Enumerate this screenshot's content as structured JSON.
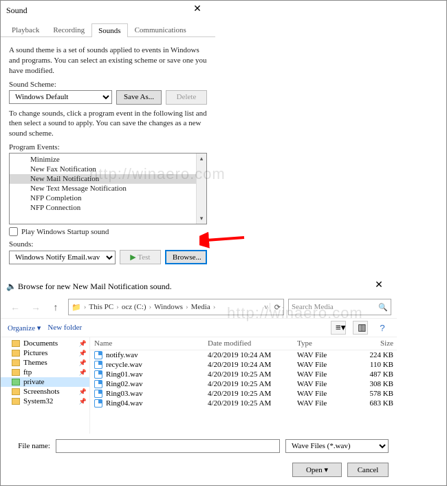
{
  "sound": {
    "title": "Sound",
    "tabs": [
      "Playback",
      "Recording",
      "Sounds",
      "Communications"
    ],
    "active_tab": 2,
    "intro": "A sound theme is a set of sounds applied to events in Windows and programs. You can select an existing scheme or save one you have modified.",
    "scheme_label": "Sound Scheme:",
    "scheme_value": "Windows Default",
    "save_as": "Save As...",
    "delete": "Delete",
    "change_hint": "To change sounds, click a program event in the following list and then select a sound to apply.  You can save the changes as a new sound scheme.",
    "events_label": "Program Events:",
    "events": [
      "Minimize",
      "New Fax Notification",
      "New Mail Notification",
      "New Text Message Notification",
      "NFP Completion",
      "NFP Connection"
    ],
    "selected_event": 2,
    "startup_label": "Play Windows Startup sound",
    "sounds_label": "Sounds:",
    "sound_value": "Windows Notify Email.wav",
    "test": "Test",
    "browse": "Browse..."
  },
  "browse": {
    "title": "Browse for new New Mail Notification sound.",
    "breadcrumb": [
      "This PC",
      "ocz (C:)",
      "Windows",
      "Media"
    ],
    "search_placeholder": "Search Media",
    "organize": "Organize",
    "new_folder": "New folder",
    "nav_items": [
      {
        "label": "Documents",
        "pin": true
      },
      {
        "label": "Pictures",
        "pin": true
      },
      {
        "label": "Themes",
        "pin": true
      },
      {
        "label": "ftp",
        "pin": true
      },
      {
        "label": "private",
        "pin": false,
        "green": true,
        "selected": true
      },
      {
        "label": "Screenshots",
        "pin": true
      },
      {
        "label": "System32",
        "pin": true
      }
    ],
    "columns": [
      "Name",
      "Date modified",
      "Type",
      "Size"
    ],
    "files": [
      {
        "name": "notify.wav",
        "date": "4/20/2019 10:24 AM",
        "type": "WAV File",
        "size": "224 KB"
      },
      {
        "name": "recycle.wav",
        "date": "4/20/2019 10:24 AM",
        "type": "WAV File",
        "size": "110 KB"
      },
      {
        "name": "Ring01.wav",
        "date": "4/20/2019 10:25 AM",
        "type": "WAV File",
        "size": "487 KB"
      },
      {
        "name": "Ring02.wav",
        "date": "4/20/2019 10:25 AM",
        "type": "WAV File",
        "size": "308 KB"
      },
      {
        "name": "Ring03.wav",
        "date": "4/20/2019 10:25 AM",
        "type": "WAV File",
        "size": "578 KB"
      },
      {
        "name": "Ring04.wav",
        "date": "4/20/2019 10:25 AM",
        "type": "WAV File",
        "size": "683 KB"
      }
    ],
    "filename_label": "File name:",
    "filename_value": "",
    "filter_value": "Wave Files (*.wav)",
    "open": "Open",
    "cancel": "Cancel"
  },
  "watermark": "http://winaero.com"
}
